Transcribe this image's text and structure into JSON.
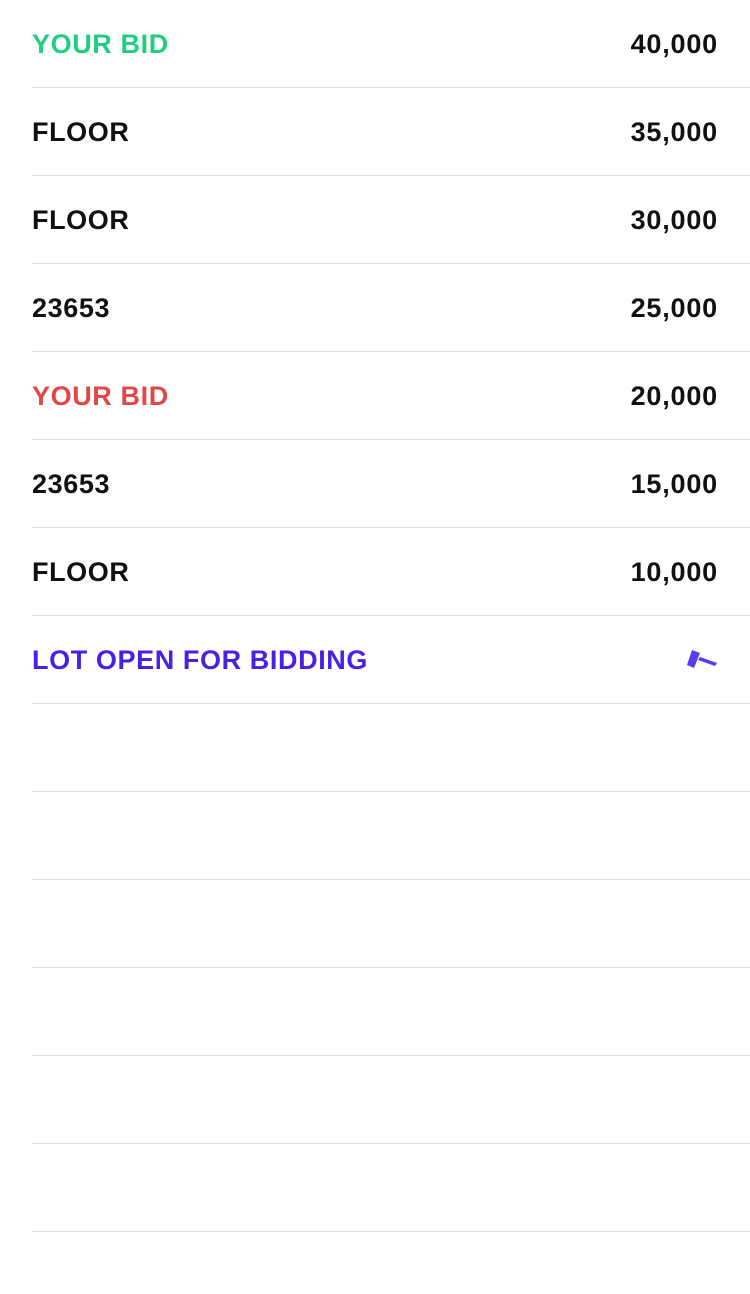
{
  "colors": {
    "green": "#1fcf7f",
    "red": "#e04848",
    "purple": "#4a1fe6",
    "gavel": "#5b3bf0",
    "default": "#111111"
  },
  "rows": [
    {
      "label": "YOUR BID",
      "amount": "40,000",
      "color": "#1fcf7f"
    },
    {
      "label": "FLOOR",
      "amount": "35,000",
      "color": "#111111"
    },
    {
      "label": "FLOOR",
      "amount": "30,000",
      "color": "#111111"
    },
    {
      "label": "23653",
      "amount": "25,000",
      "color": "#111111"
    },
    {
      "label": "YOUR BID",
      "amount": "20,000",
      "color": "#e04848"
    },
    {
      "label": "23653",
      "amount": "15,000",
      "color": "#111111"
    },
    {
      "label": "FLOOR",
      "amount": "10,000",
      "color": "#111111"
    }
  ],
  "status_row": {
    "label": "LOT OPEN FOR BIDDING",
    "icon": "gavel-icon",
    "color": "#4a1fe6"
  }
}
